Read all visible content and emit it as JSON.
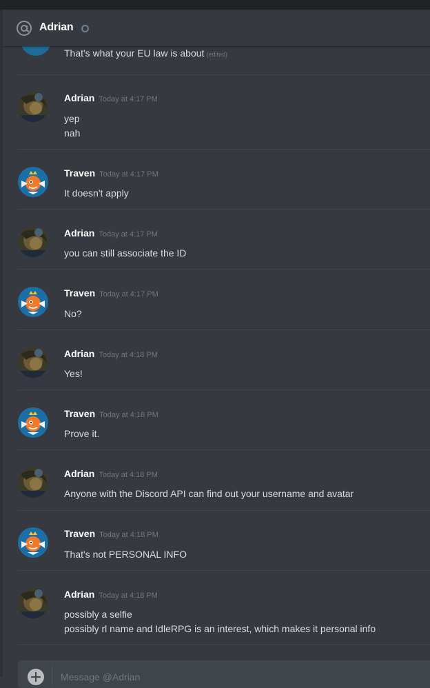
{
  "header": {
    "title": "Adrian"
  },
  "continuation": {
    "text": "That's what your EU law is about",
    "edited": "(edited)"
  },
  "messages": [
    {
      "author": "Adrian",
      "time": "Today at 4:17 PM",
      "avatar": "adrian",
      "lines": [
        "yep",
        "nah"
      ]
    },
    {
      "author": "Traven",
      "time": "Today at 4:17 PM",
      "avatar": "traven",
      "lines": [
        "It doesn't apply"
      ]
    },
    {
      "author": "Adrian",
      "time": "Today at 4:17 PM",
      "avatar": "adrian",
      "lines": [
        "you can still associate the ID"
      ]
    },
    {
      "author": "Traven",
      "time": "Today at 4:17 PM",
      "avatar": "traven",
      "lines": [
        "No?"
      ]
    },
    {
      "author": "Adrian",
      "time": "Today at 4:18 PM",
      "avatar": "adrian",
      "lines": [
        "Yes!"
      ]
    },
    {
      "author": "Traven",
      "time": "Today at 4:18 PM",
      "avatar": "traven",
      "lines": [
        "Prove it."
      ]
    },
    {
      "author": "Adrian",
      "time": "Today at 4:18 PM",
      "avatar": "adrian",
      "lines": [
        "Anyone with the Discord API can find out your username and avatar"
      ]
    },
    {
      "author": "Traven",
      "time": "Today at 4:18 PM",
      "avatar": "traven",
      "lines": [
        "That's not PERSONAL INFO"
      ]
    },
    {
      "author": "Adrian",
      "time": "Today at 4:18 PM",
      "avatar": "adrian",
      "lines": [
        "possibly a selfie",
        "possibly rl name and IdleRPG is an interest, which makes it personal info"
      ]
    }
  ],
  "composer": {
    "placeholder": "Message @Adrian"
  },
  "colors": {
    "background": "#36393f",
    "header_text": "#ffffff",
    "timestamp": "#72767d",
    "status_offline": "#747f8d"
  }
}
